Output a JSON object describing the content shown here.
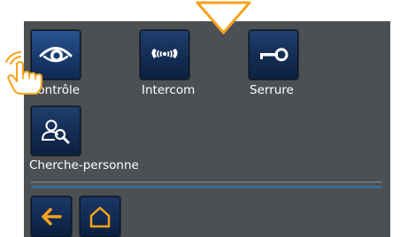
{
  "apps": [
    {
      "label": "Contrôle",
      "icon": "eye-icon",
      "selected": true
    },
    {
      "label": "Intercom",
      "icon": "intercom-icon",
      "selected": false
    },
    {
      "label": "Serrure",
      "icon": "key-icon",
      "selected": false
    },
    {
      "label": "Cherche-personne",
      "icon": "person-search-icon",
      "selected": false
    }
  ],
  "nav": {
    "back_icon": "back-arrow-icon",
    "home_icon": "home-icon"
  },
  "colors": {
    "background": "#4c5053",
    "tile": "#132c52",
    "accent_orange": "#f7a21b",
    "icon_white": "#ffffff"
  }
}
